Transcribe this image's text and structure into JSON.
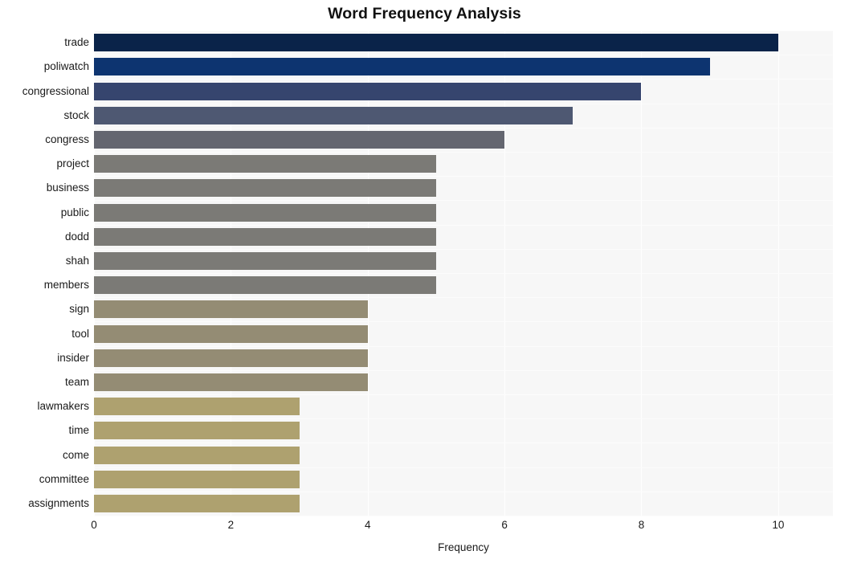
{
  "chart_data": {
    "type": "bar",
    "orientation": "horizontal",
    "title": "Word Frequency Analysis",
    "xlabel": "Frequency",
    "ylabel": "",
    "categories": [
      "trade",
      "poliwatch",
      "congressional",
      "stock",
      "congress",
      "project",
      "business",
      "public",
      "dodd",
      "shah",
      "members",
      "sign",
      "tool",
      "insider",
      "team",
      "lawmakers",
      "time",
      "come",
      "committee",
      "assignments"
    ],
    "values": [
      10,
      9,
      8,
      7,
      6,
      5,
      5,
      5,
      5,
      5,
      5,
      4,
      4,
      4,
      4,
      3,
      3,
      3,
      3,
      3
    ],
    "bar_colors": [
      "#0a2349",
      "#0d3470",
      "#36456e",
      "#4e5872",
      "#646670",
      "#7b7a76",
      "#7b7a76",
      "#7b7a76",
      "#7b7a76",
      "#7b7a76",
      "#7b7a76",
      "#948c74",
      "#948c74",
      "#948c74",
      "#948c74",
      "#aea16f",
      "#aea16f",
      "#aea16f",
      "#aea16f",
      "#aea16f"
    ],
    "xlim": [
      0,
      10.8
    ],
    "xticks": [
      0,
      2,
      4,
      6,
      8,
      10
    ],
    "xtick_labels": [
      "0",
      "2",
      "4",
      "6",
      "8",
      "10"
    ],
    "grid": true,
    "grid_color": "#ffffff",
    "plot_background": "#f7f7f7",
    "figure_background": "#ffffff",
    "legend": "none"
  }
}
